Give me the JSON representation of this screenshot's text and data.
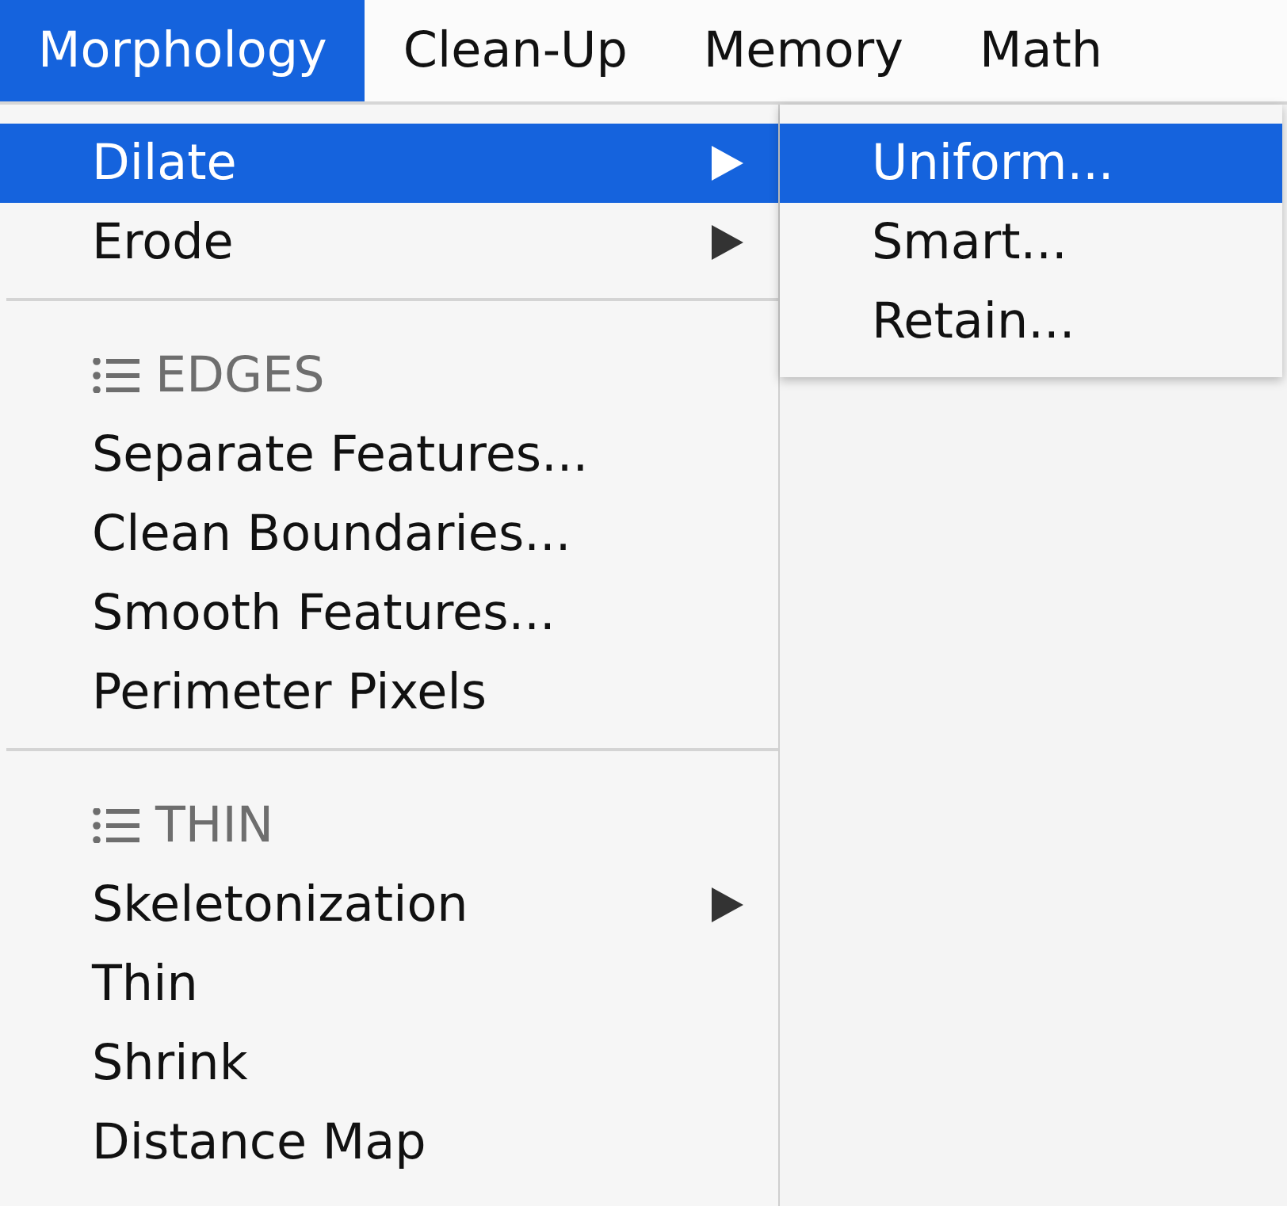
{
  "menubar": [
    {
      "label": "Morphology",
      "selected": true
    },
    {
      "label": "Clean-Up",
      "selected": false
    },
    {
      "label": "Memory",
      "selected": false
    },
    {
      "label": "Math",
      "selected": false
    }
  ],
  "menu": {
    "sections": [
      {
        "items": [
          {
            "label": "Dilate",
            "submenu": true,
            "selected": true
          },
          {
            "label": "Erode",
            "submenu": true,
            "selected": false
          }
        ]
      },
      {
        "header": "EDGES",
        "items": [
          {
            "label": "Separate Features...",
            "submenu": false,
            "selected": false
          },
          {
            "label": "Clean Boundaries...",
            "submenu": false,
            "selected": false
          },
          {
            "label": "Smooth Features...",
            "submenu": false,
            "selected": false
          },
          {
            "label": "Perimeter Pixels",
            "submenu": false,
            "selected": false
          }
        ]
      },
      {
        "header": "THIN",
        "items": [
          {
            "label": "Skeletonization",
            "submenu": true,
            "selected": false
          },
          {
            "label": "Thin",
            "submenu": false,
            "selected": false
          },
          {
            "label": "Shrink",
            "submenu": false,
            "selected": false
          },
          {
            "label": "Distance Map",
            "submenu": false,
            "selected": false
          }
        ]
      }
    ]
  },
  "submenu": {
    "items": [
      {
        "label": "Uniform...",
        "selected": true
      },
      {
        "label": "Smart...",
        "selected": false
      },
      {
        "label": "Retain...",
        "selected": false
      }
    ]
  }
}
